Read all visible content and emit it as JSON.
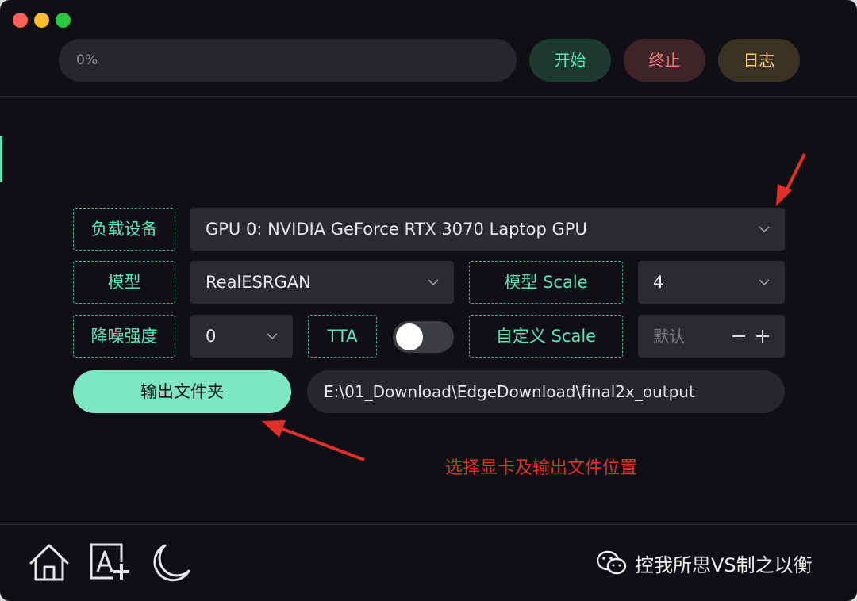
{
  "window": {
    "traffic_lights": [
      "close",
      "minimize",
      "zoom"
    ]
  },
  "toolbar": {
    "progress": {
      "value": 0,
      "text": "0%"
    },
    "start_label": "开始",
    "stop_label": "终止",
    "log_label": "日志"
  },
  "settings": {
    "device": {
      "label": "负载设备",
      "value": "GPU 0: NVIDIA GeForce RTX 3070 Laptop GPU"
    },
    "model": {
      "label": "模型",
      "value": "RealESRGAN"
    },
    "model_scale": {
      "label": "模型 Scale",
      "value": "4"
    },
    "denoise": {
      "label": "降噪强度",
      "value": "0"
    },
    "tta": {
      "label": "TTA",
      "enabled": false
    },
    "custom_scale": {
      "label": "自定义 Scale",
      "placeholder": "默认"
    },
    "output": {
      "button_label": "输出文件夹",
      "path": "E:\\01_Download\\EdgeDownload\\final2x_output"
    }
  },
  "annotation": {
    "text": "选择显卡及输出文件位置",
    "color": "#e0302a"
  },
  "bottom_bar": {
    "icons": [
      "home-icon",
      "translate-add-icon",
      "moon-icon"
    ],
    "watermark": "控我所思VS制之以衡"
  },
  "colors": {
    "accent": "#63e2b7",
    "stop": "#e87878",
    "log": "#f2c97d",
    "background": "#101014"
  }
}
